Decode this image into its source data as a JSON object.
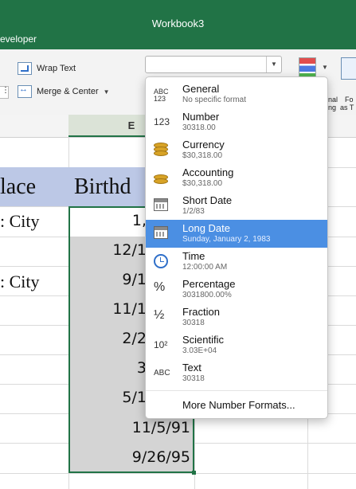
{
  "window": {
    "title": "Workbook3",
    "visible_tab": "eveloper"
  },
  "ribbon": {
    "wrap_text_label": "Wrap Text",
    "merge_center_label": "Merge & Center",
    "number_format_value": "",
    "cut_labels": [
      "nal",
      "Fo",
      "ng",
      "as T"
    ]
  },
  "grid": {
    "column_header": "E",
    "header_row": {
      "left_text": "lace",
      "right_text": "Birthd"
    },
    "city_cells": [
      ": City",
      ": City"
    ],
    "date_cells": [
      "1,",
      "12/1",
      "9/1",
      "11/1",
      "2/2",
      "3",
      "5/1",
      "11/5/91",
      "9/26/95"
    ]
  },
  "dropdown": {
    "items": [
      {
        "name": "General",
        "sub": "No specific format",
        "icon": "abc-123-icon",
        "icon_text": "ABC\n123"
      },
      {
        "name": "Number",
        "sub": "30318.00",
        "icon": "number-123-icon",
        "icon_text": "123"
      },
      {
        "name": "Currency",
        "sub": "$30,318.00",
        "icon": "coins-icon",
        "icon_text": ""
      },
      {
        "name": "Accounting",
        "sub": "$30,318.00",
        "icon": "accounting-icon",
        "icon_text": ""
      },
      {
        "name": "Short Date",
        "sub": "1/2/83",
        "icon": "calendar-icon",
        "icon_text": ""
      },
      {
        "name": "Long Date",
        "sub": "Sunday, January 2, 1983",
        "icon": "calendar-icon",
        "icon_text": "",
        "selected": true
      },
      {
        "name": "Time",
        "sub": "12:00:00 AM",
        "icon": "clock-icon",
        "icon_text": ""
      },
      {
        "name": "Percentage",
        "sub": "3031800.00%",
        "icon": "percent-icon",
        "icon_text": "%"
      },
      {
        "name": "Fraction",
        "sub": "30318",
        "icon": "fraction-icon",
        "icon_text": "½"
      },
      {
        "name": "Scientific",
        "sub": "3.03E+04",
        "icon": "scientific-icon",
        "icon_text": "10²"
      },
      {
        "name": "Text",
        "sub": "30318",
        "icon": "text-abc-icon",
        "icon_text": "ABC"
      }
    ],
    "more_label": "More Number Formats..."
  },
  "colors": {
    "excel_green": "#217346",
    "selected_item": "#4b8fe3",
    "header_row_fill": "#bcc8e6",
    "selection_fill": "#d4d4d4"
  }
}
